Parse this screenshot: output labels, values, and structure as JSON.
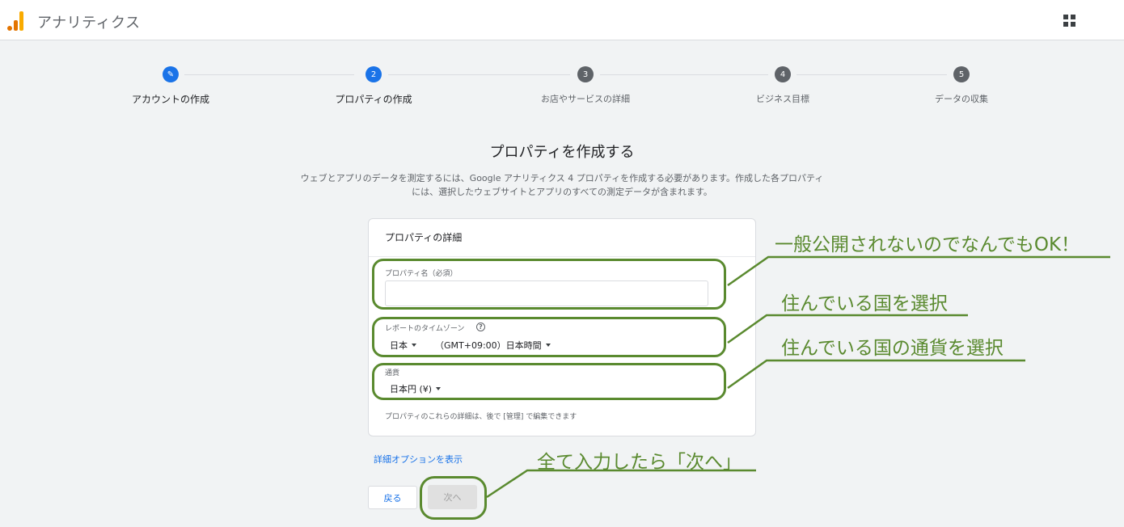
{
  "app": {
    "title": "アナリティクス"
  },
  "stepper": {
    "steps": [
      {
        "number": "✎",
        "label": "アカウントの作成"
      },
      {
        "number": "2",
        "label": "プロパティの作成"
      },
      {
        "number": "3",
        "label": "お店やサービスの詳細"
      },
      {
        "number": "4",
        "label": "ビジネス目標"
      },
      {
        "number": "5",
        "label": "データの収集"
      }
    ]
  },
  "page": {
    "heading": "プロパティを作成する",
    "description": "ウェブとアプリのデータを測定するには、Google アナリティクス 4 プロパティを作成する必要があります。作成した各プロパティには、選択したウェブサイトとアプリのすべての測定データが含まれます。"
  },
  "card": {
    "title": "プロパティの詳細",
    "property_name_label": "プロパティ名（必須）",
    "property_name_value": "",
    "timezone_label": "レポートのタイムゾーン",
    "timezone_country": "日本",
    "timezone_value": "（GMT+09:00）日本時間",
    "currency_label": "通貨",
    "currency_value": "日本円 (¥)",
    "note": "プロパティのこれらの詳細は、後で [管理] で編集できます"
  },
  "actions": {
    "advanced_options": "詳細オプションを表示",
    "back": "戻る",
    "next": "次へ"
  },
  "annotations": {
    "property_name": "一般公開されないのでなんでもOK！",
    "timezone": "住んでいる国を選択",
    "currency": "住んでいる国の通貨を選択",
    "next": "全て入力したら「次へ」"
  },
  "colors": {
    "accent": "#1a73e8",
    "annotation": "#5a8a2f"
  }
}
